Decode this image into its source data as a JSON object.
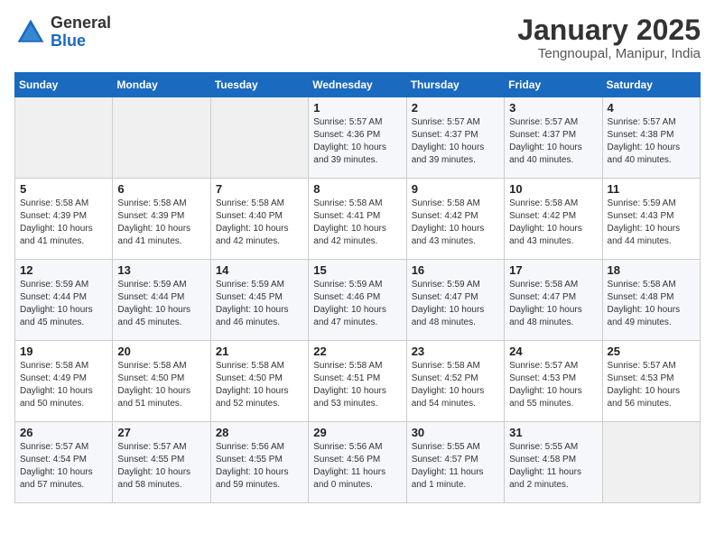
{
  "logo": {
    "general": "General",
    "blue": "Blue"
  },
  "title": "January 2025",
  "location": "Tengnoupal, Manipur, India",
  "headers": [
    "Sunday",
    "Monday",
    "Tuesday",
    "Wednesday",
    "Thursday",
    "Friday",
    "Saturday"
  ],
  "weeks": [
    [
      {
        "day": "",
        "info": ""
      },
      {
        "day": "",
        "info": ""
      },
      {
        "day": "",
        "info": ""
      },
      {
        "day": "1",
        "info": "Sunrise: 5:57 AM\nSunset: 4:36 PM\nDaylight: 10 hours\nand 39 minutes."
      },
      {
        "day": "2",
        "info": "Sunrise: 5:57 AM\nSunset: 4:37 PM\nDaylight: 10 hours\nand 39 minutes."
      },
      {
        "day": "3",
        "info": "Sunrise: 5:57 AM\nSunset: 4:37 PM\nDaylight: 10 hours\nand 40 minutes."
      },
      {
        "day": "4",
        "info": "Sunrise: 5:57 AM\nSunset: 4:38 PM\nDaylight: 10 hours\nand 40 minutes."
      }
    ],
    [
      {
        "day": "5",
        "info": "Sunrise: 5:58 AM\nSunset: 4:39 PM\nDaylight: 10 hours\nand 41 minutes."
      },
      {
        "day": "6",
        "info": "Sunrise: 5:58 AM\nSunset: 4:39 PM\nDaylight: 10 hours\nand 41 minutes."
      },
      {
        "day": "7",
        "info": "Sunrise: 5:58 AM\nSunset: 4:40 PM\nDaylight: 10 hours\nand 42 minutes."
      },
      {
        "day": "8",
        "info": "Sunrise: 5:58 AM\nSunset: 4:41 PM\nDaylight: 10 hours\nand 42 minutes."
      },
      {
        "day": "9",
        "info": "Sunrise: 5:58 AM\nSunset: 4:42 PM\nDaylight: 10 hours\nand 43 minutes."
      },
      {
        "day": "10",
        "info": "Sunrise: 5:58 AM\nSunset: 4:42 PM\nDaylight: 10 hours\nand 43 minutes."
      },
      {
        "day": "11",
        "info": "Sunrise: 5:59 AM\nSunset: 4:43 PM\nDaylight: 10 hours\nand 44 minutes."
      }
    ],
    [
      {
        "day": "12",
        "info": "Sunrise: 5:59 AM\nSunset: 4:44 PM\nDaylight: 10 hours\nand 45 minutes."
      },
      {
        "day": "13",
        "info": "Sunrise: 5:59 AM\nSunset: 4:44 PM\nDaylight: 10 hours\nand 45 minutes."
      },
      {
        "day": "14",
        "info": "Sunrise: 5:59 AM\nSunset: 4:45 PM\nDaylight: 10 hours\nand 46 minutes."
      },
      {
        "day": "15",
        "info": "Sunrise: 5:59 AM\nSunset: 4:46 PM\nDaylight: 10 hours\nand 47 minutes."
      },
      {
        "day": "16",
        "info": "Sunrise: 5:59 AM\nSunset: 4:47 PM\nDaylight: 10 hours\nand 48 minutes."
      },
      {
        "day": "17",
        "info": "Sunrise: 5:58 AM\nSunset: 4:47 PM\nDaylight: 10 hours\nand 48 minutes."
      },
      {
        "day": "18",
        "info": "Sunrise: 5:58 AM\nSunset: 4:48 PM\nDaylight: 10 hours\nand 49 minutes."
      }
    ],
    [
      {
        "day": "19",
        "info": "Sunrise: 5:58 AM\nSunset: 4:49 PM\nDaylight: 10 hours\nand 50 minutes."
      },
      {
        "day": "20",
        "info": "Sunrise: 5:58 AM\nSunset: 4:50 PM\nDaylight: 10 hours\nand 51 minutes."
      },
      {
        "day": "21",
        "info": "Sunrise: 5:58 AM\nSunset: 4:50 PM\nDaylight: 10 hours\nand 52 minutes."
      },
      {
        "day": "22",
        "info": "Sunrise: 5:58 AM\nSunset: 4:51 PM\nDaylight: 10 hours\nand 53 minutes."
      },
      {
        "day": "23",
        "info": "Sunrise: 5:58 AM\nSunset: 4:52 PM\nDaylight: 10 hours\nand 54 minutes."
      },
      {
        "day": "24",
        "info": "Sunrise: 5:57 AM\nSunset: 4:53 PM\nDaylight: 10 hours\nand 55 minutes."
      },
      {
        "day": "25",
        "info": "Sunrise: 5:57 AM\nSunset: 4:53 PM\nDaylight: 10 hours\nand 56 minutes."
      }
    ],
    [
      {
        "day": "26",
        "info": "Sunrise: 5:57 AM\nSunset: 4:54 PM\nDaylight: 10 hours\nand 57 minutes."
      },
      {
        "day": "27",
        "info": "Sunrise: 5:57 AM\nSunset: 4:55 PM\nDaylight: 10 hours\nand 58 minutes."
      },
      {
        "day": "28",
        "info": "Sunrise: 5:56 AM\nSunset: 4:55 PM\nDaylight: 10 hours\nand 59 minutes."
      },
      {
        "day": "29",
        "info": "Sunrise: 5:56 AM\nSunset: 4:56 PM\nDaylight: 11 hours\nand 0 minutes."
      },
      {
        "day": "30",
        "info": "Sunrise: 5:55 AM\nSunset: 4:57 PM\nDaylight: 11 hours\nand 1 minute."
      },
      {
        "day": "31",
        "info": "Sunrise: 5:55 AM\nSunset: 4:58 PM\nDaylight: 11 hours\nand 2 minutes."
      },
      {
        "day": "",
        "info": ""
      }
    ]
  ]
}
